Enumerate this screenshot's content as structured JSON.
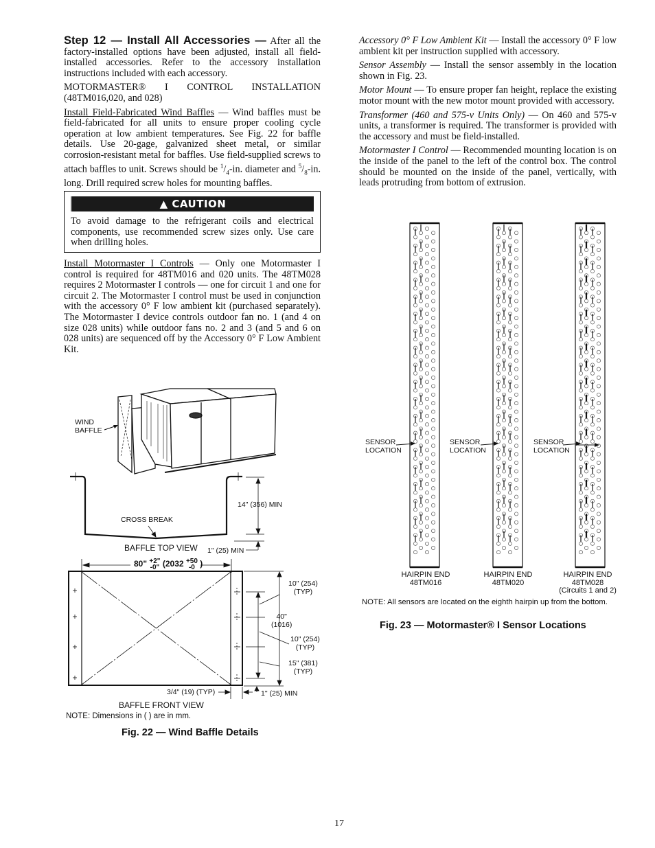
{
  "left_column": {
    "step12": {
      "heading": "Step 12 — Install All Accessories —",
      "body": " After all the factory-installed options have been adjusted, install all field-installed accessories. Refer to the accessory installation instructions included with each accessory."
    },
    "motormaster_heading": "MOTORMASTER® I CONTROL INSTALLATION (48TM016,020, and 028)",
    "wind_baffles": {
      "title": "Install Field-Fabricated Wind Baffles",
      "body_1": " — Wind baffles must be field-fabricated for all units to ensure proper cooling cycle operation at low ambient temperatures. See Fig. 22 for baffle details. Use 20-gage, galvanized sheet metal, or similar corrosion-resistant metal for baffles. Use field-supplied screws to attach baffles to unit. Screws should be ",
      "frac1_num": "1",
      "frac1_den": "4",
      "body_2": "-in. diameter and ",
      "frac2_num": "5",
      "frac2_den": "8",
      "body_3": "-in. long. Drill required screw holes for mounting baffles."
    },
    "caution": {
      "label": "CAUTION",
      "icon": "warning-triangle-icon",
      "text": "To avoid damage to the refrigerant coils and electrical components, use recommended screw sizes only. Use care when drilling holes."
    },
    "motormaster_controls": {
      "title": "Install Motormaster I Controls",
      "body": " — Only one Motormaster I control is required for 48TM016 and 020 units. The 48TM028 requires 2 Motormaster I controls — one for circuit 1 and one for circuit 2. The Motormaster I control must be used in conjunction with the accessory 0° F low ambient kit (purchased separately). The Motormaster I device controls outdoor fan   no. 1 (and 4 on size 028 units) while outdoor fans no. 2 and 3 (and 5 and 6 on 028 units) are sequenced off by the Accessory 0° F Low Ambient Kit."
    }
  },
  "right_column": {
    "paragraphs": [
      {
        "title": "Accessory 0° F Low Ambient Kit",
        "body": " — Install the accessory 0° F low ambient kit per instruction supplied with accessory."
      },
      {
        "title": "Sensor Assembly",
        "body": " — Install the sensor assembly in the location shown in Fig. 23."
      },
      {
        "title": "Motor Mount",
        "body": " — To ensure proper fan height, replace the existing motor mount with the new motor mount provided with accessory."
      },
      {
        "title": "Transformer (460 and 575-v Units Only)",
        "body": " — On 460 and 575-v units, a transformer is required. The transformer is provided with the accessory and must be field-installed."
      },
      {
        "title": "Motormaster I Control",
        "body": " — Recommended mounting location is on the inside of the panel to the left of the control box. The control should be mounted on the inside of the panel, vertically, with leads protruding from bottom of extrusion."
      }
    ]
  },
  "fig22": {
    "caption": "Fig. 22 — Wind Baffle Details",
    "labels": {
      "wind_baffle_1": "WIND",
      "wind_baffle_2": "BAFFLE",
      "cross_break": "CROSS BREAK",
      "top_view": "BAFFLE TOP VIEW",
      "dim_14": "14\" (356) MIN",
      "dim_1_top": "1\" (25) MIN",
      "width_main": "80\"",
      "width_tol_plus": "+2\"",
      "width_tol_minus": "-0\"",
      "width_mm": "(2032",
      "width_mm_plus": "+50",
      "width_mm_minus": "-0",
      "width_mm_close": ")",
      "dim_10a_1": "10\" (254)",
      "dim_10a_2": "(TYP)",
      "dim_40_1": "40\"",
      "dim_40_2": "(1016)",
      "dim_10b_1": "10\" (254)",
      "dim_10b_2": "(TYP)",
      "dim_15_1": "15\" (381)",
      "dim_15_2": "(TYP)",
      "dim_3_4": "3/4\" (19) (TYP)",
      "dim_1_bottom": "1\" (25) MIN",
      "front_view": "BAFFLE FRONT VIEW",
      "note": "NOTE: Dimensions in (   ) are in mm."
    }
  },
  "fig23": {
    "caption": "Fig. 23 — Motormaster® I Sensor Locations",
    "coils": [
      {
        "model": "48TM016",
        "end_label": "HAIRPIN END",
        "sensor_label_1": "SENSOR",
        "sensor_label_2": "LOCATION",
        "sub": ""
      },
      {
        "model": "48TM020",
        "end_label": "HAIRPIN END",
        "sensor_label_1": "SENSOR",
        "sensor_label_2": "LOCATION",
        "sub": ""
      },
      {
        "model": "48TM028",
        "end_label": "HAIRPIN END",
        "sensor_label_1": "SENSOR",
        "sensor_label_2": "LOCATION",
        "sub": "(Circuits 1 and 2)"
      }
    ],
    "note": "NOTE: All sensors are located on the eighth hairpin up from the bottom."
  },
  "page_number": "17"
}
